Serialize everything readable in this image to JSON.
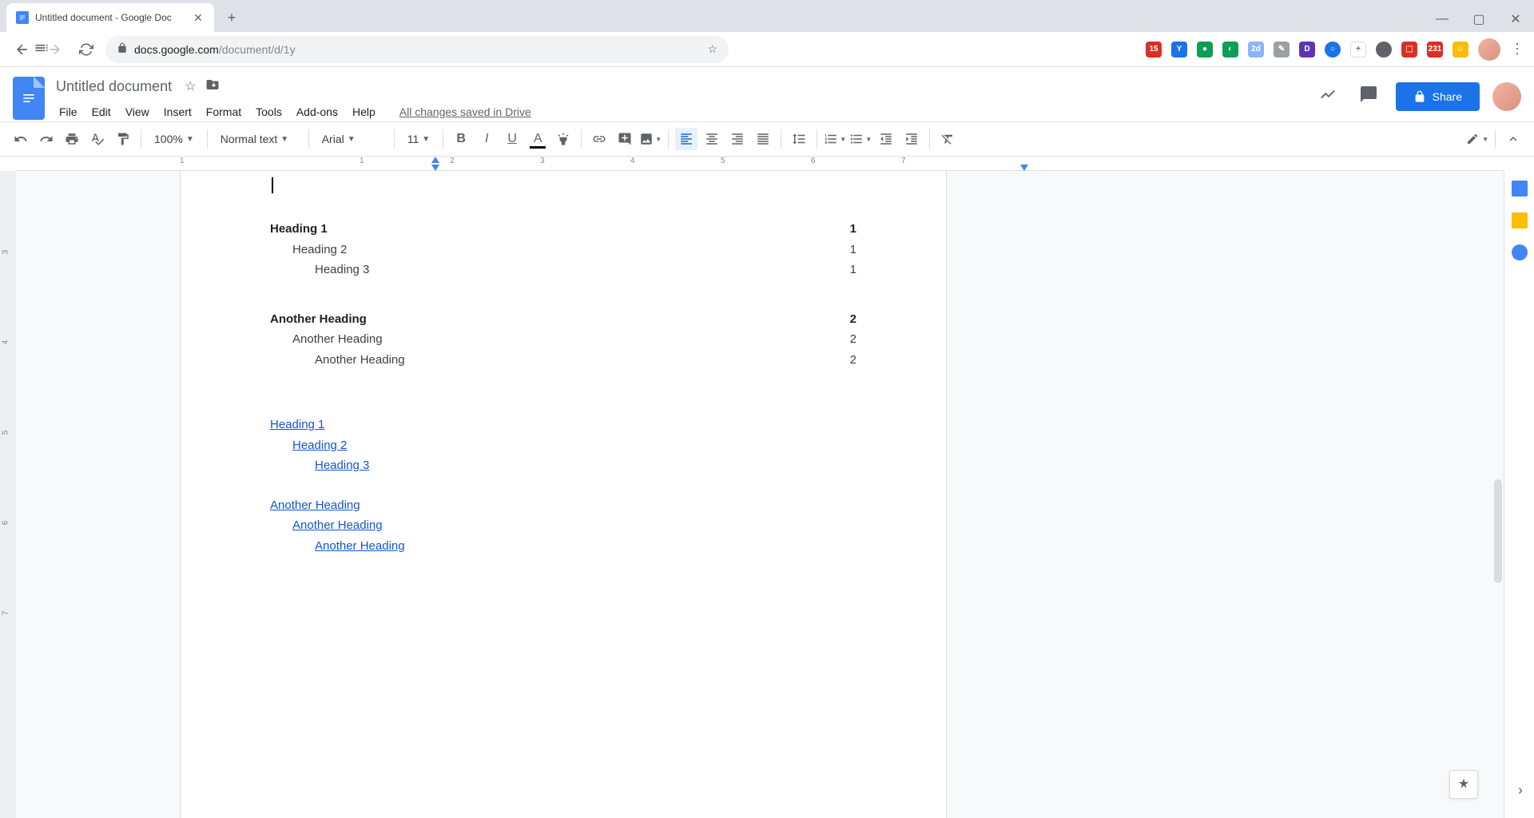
{
  "browser": {
    "tab_title": "Untitled document - Google Doc",
    "url_host": "docs.google.com",
    "url_path": "/document/d/1y"
  },
  "header": {
    "title": "Untitled document",
    "saved_status": "All changes saved in Drive",
    "share_label": "Share",
    "menu": [
      "File",
      "Edit",
      "View",
      "Insert",
      "Format",
      "Tools",
      "Add-ons",
      "Help"
    ]
  },
  "toolbar": {
    "zoom": "100%",
    "style": "Normal text",
    "font": "Arial",
    "size": "11"
  },
  "ruler": {
    "ticks": [
      "1",
      "1",
      "2",
      "3",
      "4",
      "5",
      "6",
      "7"
    ]
  },
  "vruler": [
    "3",
    "4",
    "5",
    "6",
    "7"
  ],
  "toc_numbered": [
    {
      "level": 1,
      "text": "Heading 1",
      "page": "1"
    },
    {
      "level": 2,
      "text": "Heading 2",
      "page": "1"
    },
    {
      "level": 3,
      "text": "Heading 3",
      "page": "1"
    },
    {
      "level": 1,
      "text": "Another Heading",
      "page": "2"
    },
    {
      "level": 2,
      "text": "Another Heading",
      "page": "2"
    },
    {
      "level": 3,
      "text": "Another Heading",
      "page": "2"
    }
  ],
  "toc_links": [
    {
      "level": 1,
      "text": "Heading 1"
    },
    {
      "level": 2,
      "text": "Heading 2"
    },
    {
      "level": 3,
      "text": "Heading 3"
    },
    {
      "level": 1,
      "text": "Another Heading"
    },
    {
      "level": 2,
      "text": "Another Heading"
    },
    {
      "level": 3,
      "text": "Another Heading"
    }
  ]
}
